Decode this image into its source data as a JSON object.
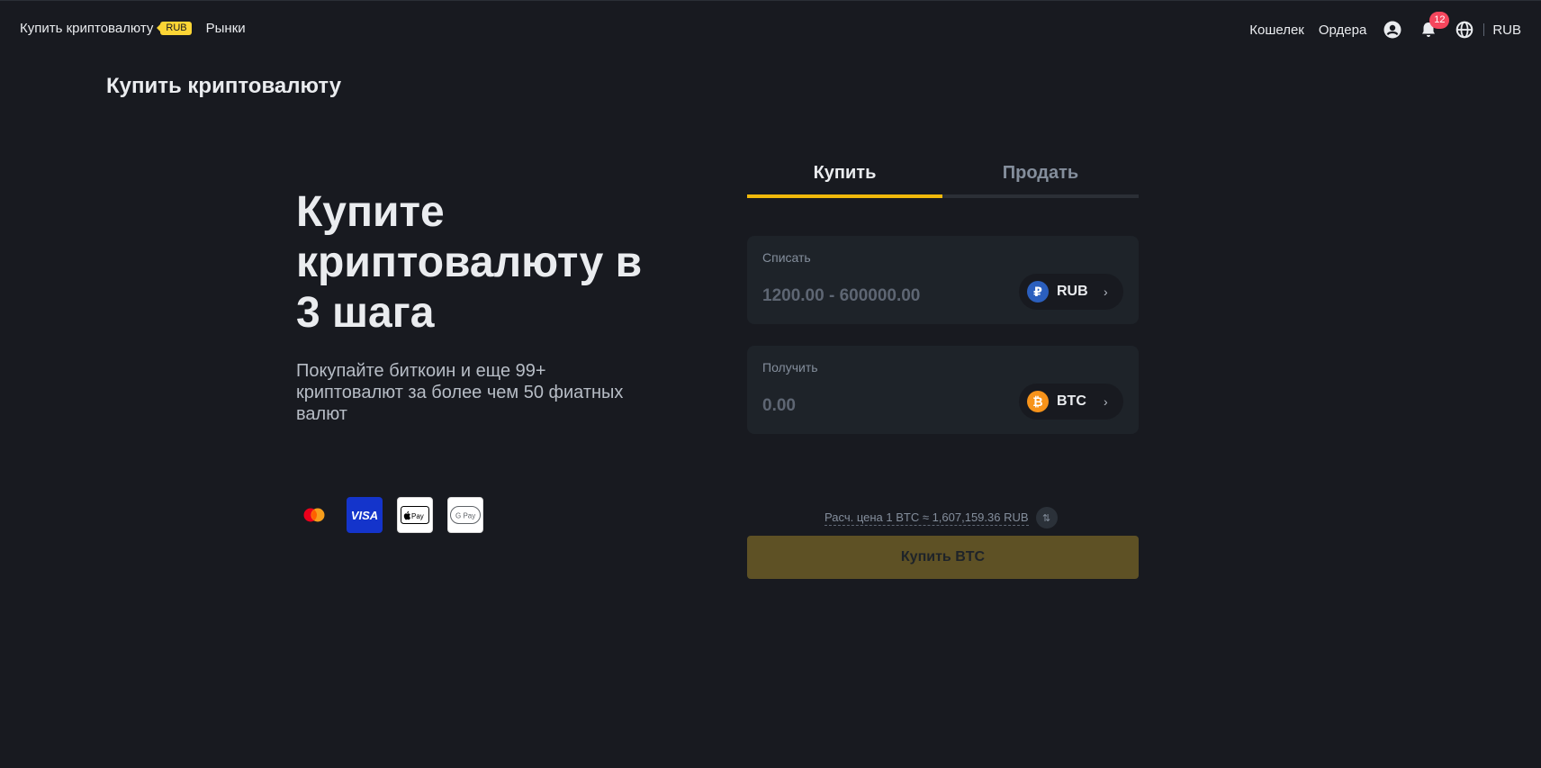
{
  "nav": {
    "buy_crypto": "Купить криптовалюту",
    "currency_badge": "RUB",
    "markets": "Рынки",
    "wallet": "Кошелек",
    "orders": "Ордера",
    "notification_count": "12",
    "fiat": "RUB",
    "icons": [
      "user-icon",
      "bell-icon",
      "globe-icon"
    ]
  },
  "page": {
    "title": "Купить криптовалюту"
  },
  "hero": {
    "title": "Купите криптовалюту в 3 шага",
    "subtitle": "Покупайте биткоин и еще 99+ криптовалют за более чем 50 фиатных валют",
    "payment_methods": [
      "mastercard",
      "VISA",
      "Pay",
      "G Pay"
    ]
  },
  "trade": {
    "tab_buy": "Купить",
    "tab_sell": "Продать",
    "spend": {
      "label": "Списать",
      "placeholder": "1200.00 - 600000.00",
      "currency": "RUB",
      "currency_symbol": "₽"
    },
    "receive": {
      "label": "Получить",
      "placeholder": "0.00",
      "currency": "BTC",
      "currency_symbol": "₿"
    },
    "rate": "Расч. цена 1 BTC ≈ 1,607,159.36 RUB",
    "buy_button": "Купить BTC"
  },
  "colors": {
    "background": "#181a20",
    "accent": "#f0b90b",
    "panel": "#1e2329",
    "notif": "#f6465d"
  }
}
